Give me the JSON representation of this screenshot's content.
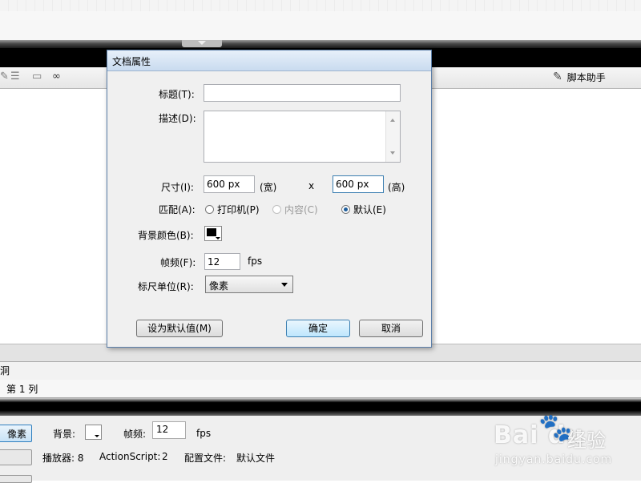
{
  "app": {
    "script_helper_label": "脚本助手",
    "status_text_1": "洞",
    "status_text_2": "第 1 列"
  },
  "properties": {
    "size_button_label": "像素",
    "background_label": "背景:",
    "fps_label": "帧频:",
    "fps_value": "12",
    "fps_unit": "fps",
    "player_label": "播放器: 8",
    "actionscript_label": "ActionScript:",
    "actionscript_value": "2",
    "profile_label": "配置文件:",
    "profile_value": "默认文件"
  },
  "watermark": {
    "brand": "Bai du",
    "jingyan": "经验",
    "url": "jingyan.baidu.com"
  },
  "dialog": {
    "title": "文档属性",
    "title_label": "标题(T):",
    "title_value": "",
    "desc_label": "描述(D):",
    "desc_value": "",
    "size_label": "尺寸(I):",
    "width_value": "600 px",
    "width_unit": "(宽)",
    "x_sep": "x",
    "height_value": "600 px",
    "height_unit": "(高)",
    "match_label": "匹配(A):",
    "match_options": [
      "打印机(P)",
      "内容(C)",
      "默认(E)"
    ],
    "match_selected": "默认(E)",
    "bgcolor_label": "背景颜色(B):",
    "bgcolor_value": "#000000",
    "fps_label": "帧频(F):",
    "fps_value": "12",
    "fps_unit": "fps",
    "units_label": "标尺单位(R):",
    "units_value": "像素",
    "set_default_label": "设为默认值(M)",
    "ok_label": "确定",
    "cancel_label": "取消"
  },
  "colors": {
    "dialog_border": "#5b7ea8",
    "ok_button": "#bee6fd",
    "radio_dot": "#1d5d9b"
  }
}
